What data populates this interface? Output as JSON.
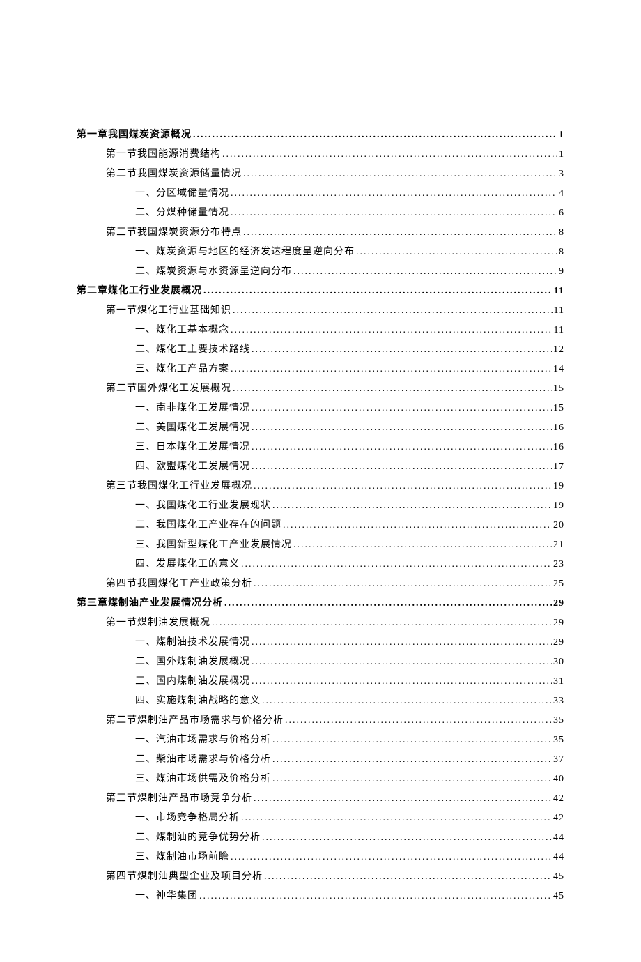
{
  "toc": [
    {
      "level": 1,
      "title": "第一章我国煤炭资源概况",
      "page": "1"
    },
    {
      "level": 2,
      "title": "第一节我国能源消费结构",
      "page": "1"
    },
    {
      "level": 2,
      "title": "第二节我国煤炭资源储量情况",
      "page": "3"
    },
    {
      "level": 3,
      "title": "一、分区域储量情况",
      "page": "4"
    },
    {
      "level": 3,
      "title": "二、分煤种储量情况",
      "page": "6"
    },
    {
      "level": 2,
      "title": "第三节我国煤炭资源分布特点",
      "page": "8"
    },
    {
      "level": 3,
      "title": "一、煤炭资源与地区的经济发达程度呈逆向分布",
      "page": "8"
    },
    {
      "level": 3,
      "title": "二、煤炭资源与水资源呈逆向分布",
      "page": "9"
    },
    {
      "level": 1,
      "title": "第二章煤化工行业发展概况",
      "page": "11"
    },
    {
      "level": 2,
      "title": "第一节煤化工行业基础知识",
      "page": "11"
    },
    {
      "level": 3,
      "title": "一、煤化工基本概念",
      "page": "11"
    },
    {
      "level": 3,
      "title": "二、煤化工主要技术路线",
      "page": "12"
    },
    {
      "level": 3,
      "title": "三、煤化工产品方案",
      "page": "14"
    },
    {
      "level": 2,
      "title": "第二节国外煤化工发展概况",
      "page": "15"
    },
    {
      "level": 3,
      "title": "一、南非煤化工发展情况",
      "page": "15"
    },
    {
      "level": 3,
      "title": "二、美国煤化工发展情况",
      "page": "16"
    },
    {
      "level": 3,
      "title": "三、日本煤化工发展情况",
      "page": "16"
    },
    {
      "level": 3,
      "title": "四、欧盟煤化工发展情况",
      "page": "17"
    },
    {
      "level": 2,
      "title": "第三节我国煤化工行业发展概况",
      "page": "19"
    },
    {
      "level": 3,
      "title": "一、我国煤化工行业发展现状",
      "page": "19"
    },
    {
      "level": 3,
      "title": "二、我国煤化工产业存在的问题",
      "page": "20"
    },
    {
      "level": 3,
      "title": "三、我国新型煤化工产业发展情况",
      "page": "21"
    },
    {
      "level": 3,
      "title": "四、发展煤化工的意义",
      "page": "23"
    },
    {
      "level": 2,
      "title": "第四节我国煤化工产业政策分析",
      "page": "25"
    },
    {
      "level": 1,
      "title": "第三章煤制油产业发展情况分析",
      "page": "29"
    },
    {
      "level": 2,
      "title": "第一节煤制油发展概况",
      "page": "29"
    },
    {
      "level": 3,
      "title": "一、煤制油技术发展情况",
      "page": "29"
    },
    {
      "level": 3,
      "title": "二、国外煤制油发展概况",
      "page": "30"
    },
    {
      "level": 3,
      "title": "三、国内煤制油发展概况",
      "page": "31"
    },
    {
      "level": 3,
      "title": "四、实施煤制油战略的意义",
      "page": "33"
    },
    {
      "level": 2,
      "title": "第二节煤制油产品市场需求与价格分析",
      "page": "35"
    },
    {
      "level": 3,
      "title": "一、汽油市场需求与价格分析",
      "page": "35"
    },
    {
      "level": 3,
      "title": "二、柴油市场需求与价格分析",
      "page": "37"
    },
    {
      "level": 3,
      "title": "三、煤油市场供需及价格分析",
      "page": "40"
    },
    {
      "level": 2,
      "title": "第三节煤制油产品市场竞争分析",
      "page": "42"
    },
    {
      "level": 3,
      "title": "一、市场竞争格局分析",
      "page": "42"
    },
    {
      "level": 3,
      "title": "二、煤制油的竞争优势分析",
      "page": "44"
    },
    {
      "level": 3,
      "title": "三、煤制油市场前瞻",
      "page": "44"
    },
    {
      "level": 2,
      "title": "第四节煤制油典型企业及项目分析",
      "page": "45"
    },
    {
      "level": 3,
      "title": "一、神华集团",
      "page": "45"
    }
  ]
}
